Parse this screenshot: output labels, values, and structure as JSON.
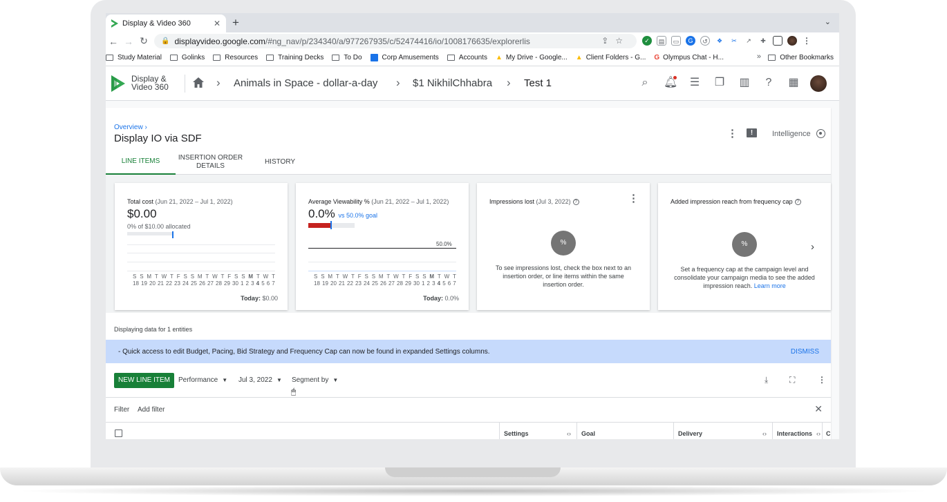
{
  "browser": {
    "tab_title": "Display & Video 360",
    "url_host": "displayvideo.google.com",
    "url_path": "/#ng_nav/p/234340/a/977267935/c/52474416/io/1008176635/explorerlis",
    "bookmarks": [
      "Study Material",
      "Golinks",
      "Resources",
      "Training Decks",
      "To Do",
      "Corp Amusements",
      "Accounts",
      "My Drive - Google...",
      "Client Folders - G...",
      "Olympus Chat - H..."
    ],
    "other_bookmarks": "Other Bookmarks"
  },
  "app": {
    "logo_line1": "Display &",
    "logo_line2": "Video 360",
    "breadcrumbs": [
      "Animals in Space - dollar-a-day",
      "$1 NikhilChhabra",
      "Test 1"
    ]
  },
  "page": {
    "overview_link": "Overview ›",
    "title": "Display IO via SDF",
    "intelligence": "Intelligence",
    "tabs": [
      "LINE ITEMS",
      "INSERTION ORDER DETAILS",
      "HISTORY"
    ]
  },
  "scorecards": {
    "total_cost": {
      "title": "Total cost",
      "range": "(Jun 21, 2022 – Jul 1, 2022)",
      "value": "$0.00",
      "sub": "0% of $10.00 allocated",
      "today": "$0.00",
      "today_label": "Today:"
    },
    "viewability": {
      "title": "Average Viewability %",
      "range": "(Jun 21, 2022 – Jul 1, 2022)",
      "value": "0.0%",
      "goal": "vs 50.0% goal",
      "goal_line_label": "50.0%",
      "today": "0.0%",
      "today_label": "Today:",
      "progress_fraction": 0.0
    },
    "impressions_lost": {
      "title": "Impressions lost",
      "range": "(Jul 3, 2022)",
      "pct_symbol": "%",
      "message": "To see impressions lost, check the box next to an insertion order, or line items within the same insertion order."
    },
    "freq_cap": {
      "title": "Added impression reach from frequency cap",
      "pct_symbol": "%",
      "message": "Set a frequency cap at the campaign level and consolidate your campaign media to see the added impression reach.",
      "learn_more": "Learn more"
    },
    "day_letters": [
      "S",
      "S",
      "M",
      "T",
      "W",
      "T",
      "F",
      "S",
      "S",
      "M",
      "T",
      "W",
      "T",
      "F",
      "S",
      "S",
      "M",
      "T",
      "W",
      "T"
    ],
    "day_numbers": [
      "18",
      "19",
      "20",
      "21",
      "22",
      "23",
      "24",
      "25",
      "26",
      "27",
      "28",
      "29",
      "30",
      "1",
      "2",
      "3",
      "4",
      "5",
      "6",
      "7"
    ]
  },
  "status": {
    "entities": "Displaying data for 1 entities",
    "banner": "- Quick access to edit Budget, Pacing, Bid Strategy and Frequency Cap can now be found in expanded Settings columns.",
    "dismiss": "DISMISS"
  },
  "toolbar": {
    "new_line_item": "NEW LINE ITEM",
    "performance": "Performance",
    "date": "Jul 3, 2022",
    "segment": "Segment by"
  },
  "filter": {
    "label": "Filter",
    "add": "Add filter"
  },
  "table": {
    "columns": [
      "Settings",
      "Goal",
      "Delivery",
      "Interactions",
      "C"
    ]
  }
}
